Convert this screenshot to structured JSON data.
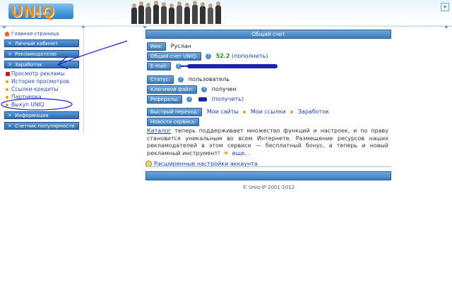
{
  "header": {
    "logo_text": "UNIQ",
    "logo_url": "ip.com"
  },
  "sidebar": {
    "home": "Главная страница",
    "buttons": [
      {
        "label": "Личный кабинет"
      },
      {
        "label": "Рекламодателю"
      },
      {
        "label": "Заработок"
      },
      {
        "label": "Информация"
      },
      {
        "label": "Счетчик популярности"
      }
    ],
    "earn_items": [
      {
        "label": "Просмотр рекламы"
      },
      {
        "label": "История просмотров"
      },
      {
        "label": "Ссылки-кредиты"
      },
      {
        "label": "Партнерка"
      },
      {
        "label": "Выкуп UNIQ"
      }
    ]
  },
  "main": {
    "title": "Общий счет",
    "name_label": "Имя:",
    "name_value": "Руслан",
    "balance_label": "Общий счет UNIQ:",
    "balance_value": "52.2",
    "balance_link": "(пополнить)",
    "email_label": "E-mail:",
    "status_label": "Статус:",
    "status_value": "пользователь",
    "keyfile_label": "Ключевой файл:",
    "keyfile_value": "получен",
    "referrals_label": "Рефералы:",
    "referrals_link": "(получить)",
    "quick_label": "Быстрый переход:",
    "quick_links": [
      "Мои сайты",
      "Мои ссылки",
      "Заработок"
    ],
    "news_label": "Новости сервиса:",
    "desc_catalog": "Каталог",
    "desc_text": "теперь поддерживает множество функций и настроек, и по праву становится уникальным во всем Интернете. Размещение ресурсов наших рекламодателей в этом сервисе — бесплатный бонус, а теперь и новый рекламный инструмент!",
    "desc_more": "еще...",
    "advanced": "Расширенные настройки аккаунта",
    "copyright": "© Uniq-IP 2001-2012"
  },
  "colors": {
    "button_blue": "#3d7bb8",
    "link_blue": "#1a3ea8",
    "balance_green": "#2d8a1f",
    "bullet_orange": "#f09a1a",
    "annotation_ink": "#1c1cc8"
  }
}
